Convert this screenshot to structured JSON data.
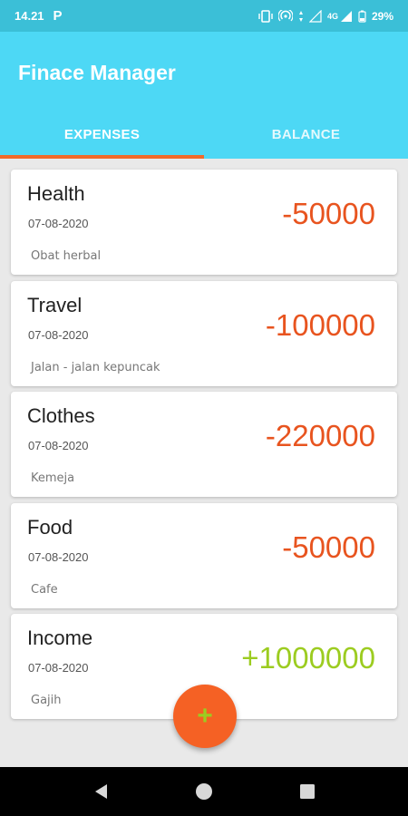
{
  "status_bar": {
    "time": "14.21",
    "p_label": "P",
    "network": "4G",
    "battery": "29%"
  },
  "app": {
    "title": "Finace Manager"
  },
  "tabs": [
    {
      "label": "EXPENSES",
      "active": true
    },
    {
      "label": "BALANCE",
      "active": false
    }
  ],
  "expenses": [
    {
      "category": "Health",
      "date": "07-08-2020",
      "note": "Obat herbal",
      "amount": "-50000",
      "color": "#e8541f"
    },
    {
      "category": "Travel",
      "date": "07-08-2020",
      "note": "Jalan - jalan kepuncak",
      "amount": "-100000",
      "color": "#e8541f"
    },
    {
      "category": "Clothes",
      "date": "07-08-2020",
      "note": "Kemeja",
      "amount": "-220000",
      "color": "#e8541f"
    },
    {
      "category": "Food",
      "date": "07-08-2020",
      "note": "Cafe",
      "amount": "-50000",
      "color": "#e8541f"
    },
    {
      "category": "Income",
      "date": "07-08-2020",
      "note": "Gajih",
      "amount": "+1000000",
      "color": "#9ccc20"
    }
  ],
  "fab": {
    "icon": "plus-icon",
    "label": "+"
  },
  "colors": {
    "status_bar": "#3bbfd7",
    "app_bar": "#4dd8f5",
    "accent": "#f06a2a",
    "expense": "#e8541f",
    "income": "#9ccc20"
  }
}
